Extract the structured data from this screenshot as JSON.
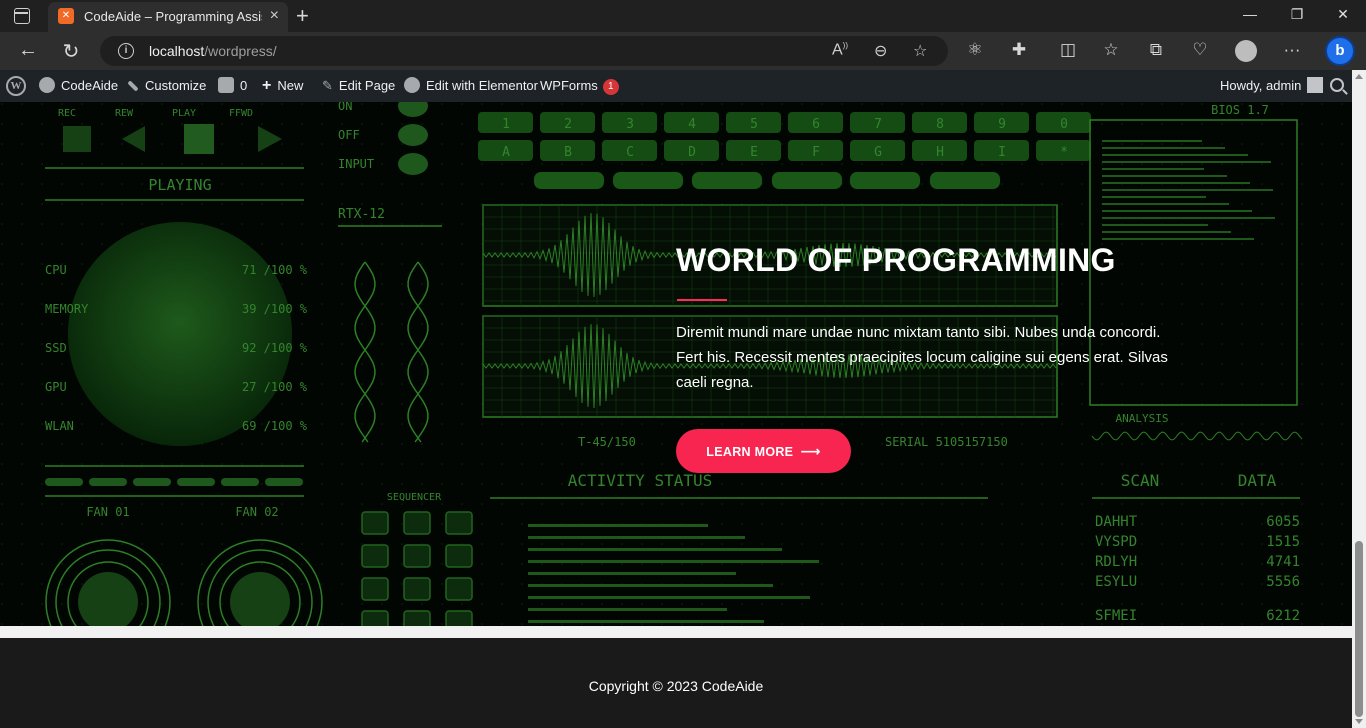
{
  "browser": {
    "tab_title": "CodeAide – Programming Assistant",
    "tab_favicon": "xampp-icon",
    "url_host": "localhost",
    "url_path": "/wordpress/"
  },
  "admin_bar": {
    "site_name": "CodeAide",
    "customize": "Customize",
    "comments_count": "0",
    "new": "New",
    "edit_page": "Edit Page",
    "edit_elementor": "Edit with Elementor",
    "wpforms": "WPForms",
    "wpforms_badge": "1",
    "howdy": "Howdy, admin"
  },
  "hero": {
    "title": "WORLD OF PROGRAMMING",
    "text": "Diremit mundi mare undae nunc mixtam tanto sibi. Nubes unda concordi. Fert his. Recessit mentes praecipites locum caligine sui egens erat. Silvas caeli regna.",
    "button_label": "LEARN MORE",
    "accent_color": "#f7254f"
  },
  "footer": {
    "copyright": "Copyright © 2023 CodeAide"
  },
  "hud": {
    "transport": [
      "REC",
      "REW",
      "PLAY",
      "FFWD"
    ],
    "playing": "PLAYING",
    "stats": [
      {
        "label": "CPU",
        "value": "71 /100 %"
      },
      {
        "label": "MEMORY",
        "value": "39 /100 %"
      },
      {
        "label": "SSD",
        "value": "92 /100 %"
      },
      {
        "label": "GPU",
        "value": "27 /100 %"
      },
      {
        "label": "WLAN",
        "value": "69 /100 %"
      }
    ],
    "fans": [
      "FAN 01",
      "FAN 02"
    ],
    "switches": [
      "ON",
      "OFF",
      "INPUT"
    ],
    "rtx": "RTX-12",
    "sequencer": "SEQUENCER",
    "keys_top": [
      "1",
      "2",
      "3",
      "4",
      "5",
      "6",
      "7",
      "8",
      "9",
      "0"
    ],
    "keys_mid": [
      "A",
      "B",
      "C",
      "D",
      "E",
      "F",
      "G",
      "H",
      "I",
      "*"
    ],
    "bios": "BIOS 1.7",
    "analysis": "ANALYSIS",
    "activity": "ACTIVITY STATUS",
    "serial": "SERIAL 5105157150",
    "t_code": "T-45/150",
    "scan": "SCAN",
    "data_label": "DATA",
    "scan_rows": [
      [
        "DAHHT",
        "6055"
      ],
      [
        "VYSPD",
        "1515"
      ],
      [
        "RDLYH",
        "4741"
      ],
      [
        "ESYLU",
        "5556"
      ],
      [
        "SFMEI",
        "6212"
      ]
    ]
  }
}
